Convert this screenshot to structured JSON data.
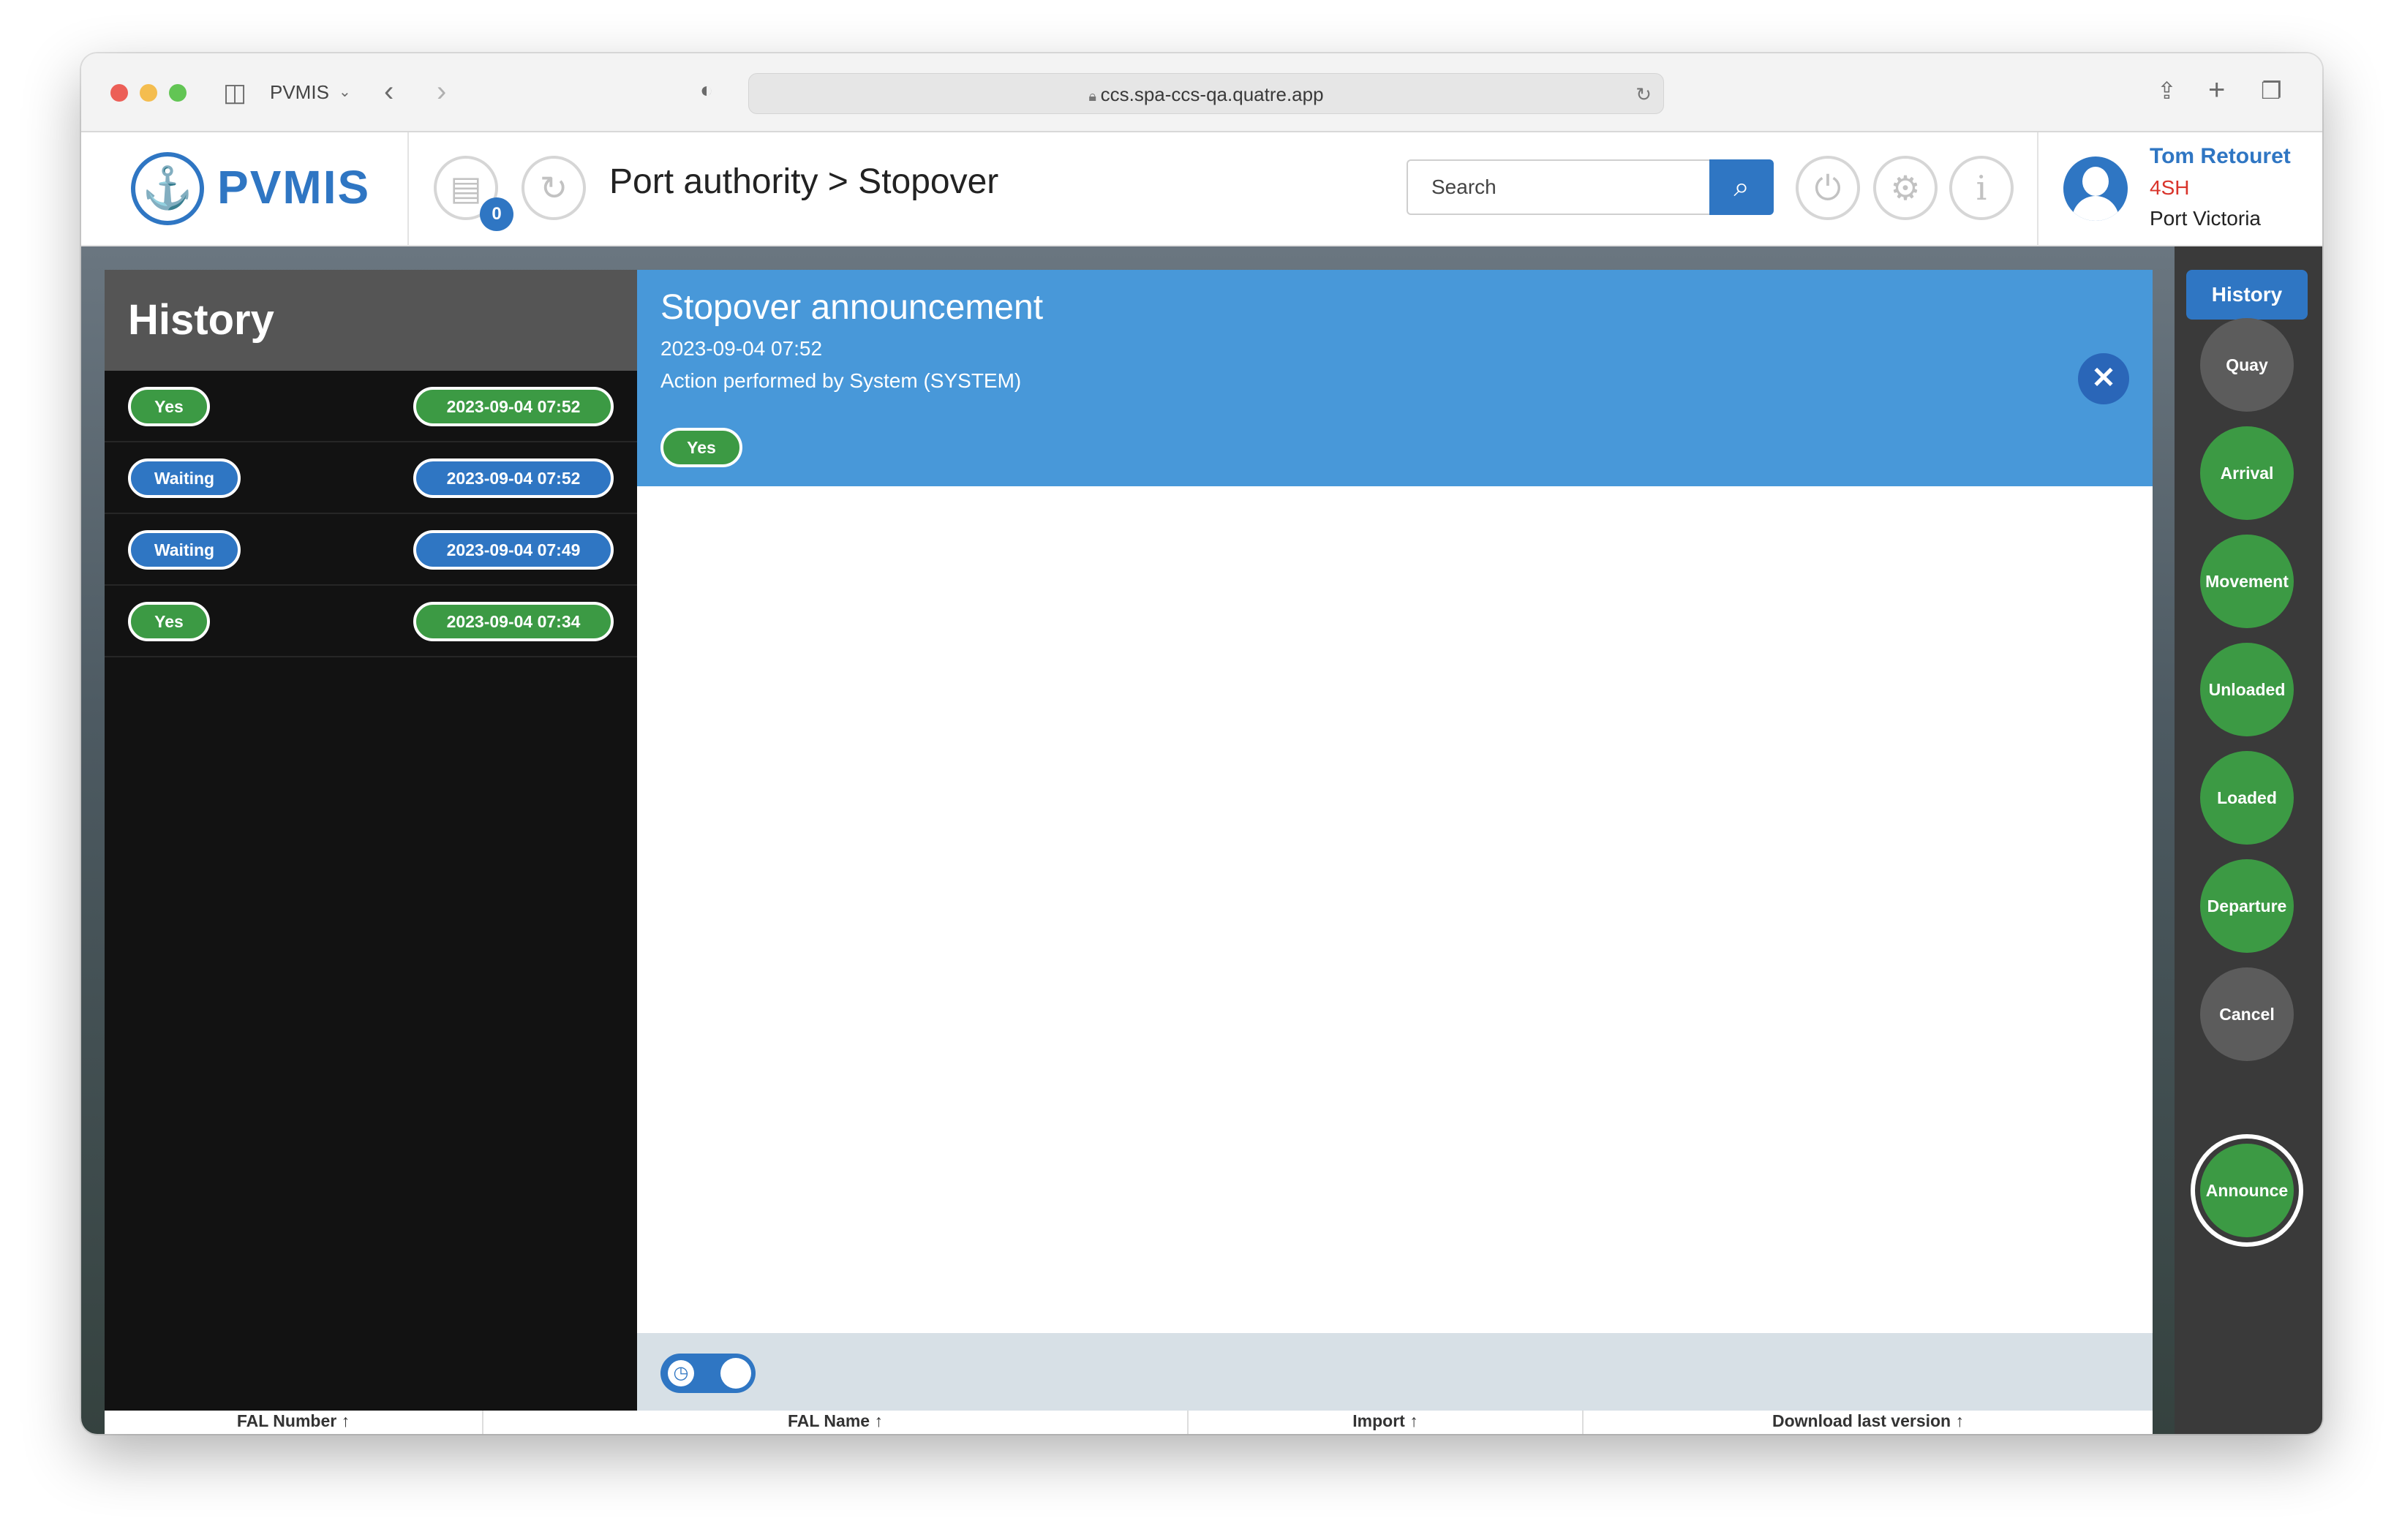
{
  "browser": {
    "tab_group": "PVMIS",
    "url": "ccs.spa-ccs-qa.quatre.app"
  },
  "app": {
    "logo_text": "PVMIS",
    "notifications_count": "0",
    "breadcrumb": "Port authority > Stopover",
    "search_placeholder": "Search"
  },
  "user": {
    "name": "Tom Retouret",
    "code": "4SH",
    "port": "Port Victoria"
  },
  "history": {
    "title": "History",
    "rows": [
      {
        "status": "Yes",
        "status_color": "#3c9a44",
        "datetime": "2023-09-04 07:52"
      },
      {
        "status": "Waiting",
        "status_color": "#2f76c3",
        "datetime": "2023-09-04 07:52"
      },
      {
        "status": "Waiting",
        "status_color": "#2f76c3",
        "datetime": "2023-09-04 07:49"
      },
      {
        "status": "Yes",
        "status_color": "#3c9a44",
        "datetime": "2023-09-04 07:34"
      }
    ]
  },
  "detail": {
    "title": "Stopover announcement",
    "datetime": "2023-09-04 07:52",
    "performed_by": "Action performed by System (SYSTEM)",
    "status": "Yes"
  },
  "table": {
    "columns": [
      "FAL Number",
      "FAL Name",
      "Import",
      "Download last version"
    ]
  },
  "rail": {
    "history_label": "History",
    "steps": [
      {
        "label": "Quay",
        "state": "inactive"
      },
      {
        "label": "Arrival",
        "state": "done"
      },
      {
        "label": "Movement",
        "state": "done"
      },
      {
        "label": "Unloaded",
        "state": "done"
      },
      {
        "label": "Loaded",
        "state": "done"
      },
      {
        "label": "Departure",
        "state": "done"
      },
      {
        "label": "Cancel",
        "state": "inactive"
      },
      {
        "label": "Announce",
        "state": "current"
      }
    ]
  },
  "colors": {
    "brand_blue": "#2f76c3",
    "success_green": "#3c9a44",
    "header_blue": "#4898d9",
    "user_code_red": "#d9342b"
  }
}
